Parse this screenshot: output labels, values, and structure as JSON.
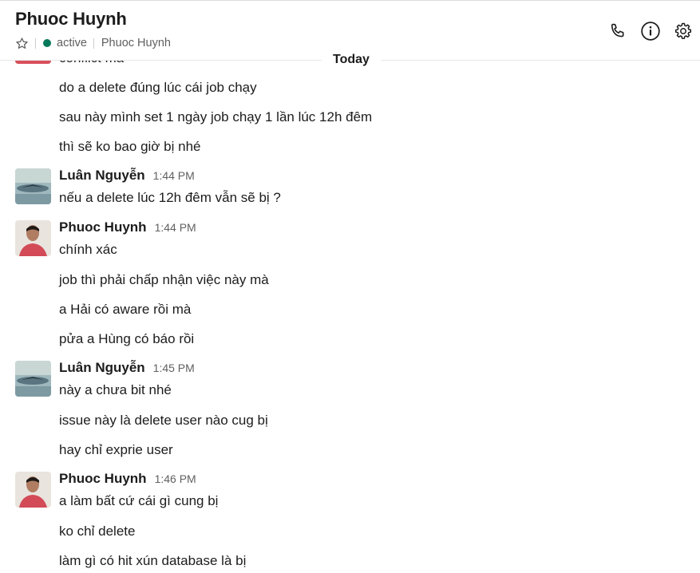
{
  "header": {
    "title": "Phuoc Huynh",
    "status": "active",
    "subtitle_name": "Phuoc Huynh",
    "icons": [
      "star-icon",
      "phone-icon",
      "info-icon",
      "gear-icon"
    ]
  },
  "divider_label": "Today",
  "cut_off_line": "conflict mà",
  "groups": [
    {
      "lines": [
        "do a delete đúng lúc cái job chạy",
        "sau này mình set 1 ngày job chạy 1 lần lúc 12h đêm",
        "thì sẽ ko bao giờ bị nhé"
      ]
    },
    {
      "author": "Luân Nguyễn",
      "time": "1:44 PM",
      "lines": [
        "nếu a delete lúc 12h đêm vẫn sẽ bị ?"
      ]
    },
    {
      "author": "Phuoc Huynh",
      "time": "1:44 PM",
      "lines": [
        "chính xác",
        "job thì phải chấp nhận việc này mà",
        "a Hải có aware rồi mà",
        "pửa a Hùng có báo rồi"
      ]
    },
    {
      "author": "Luân Nguyễn",
      "time": "1:45 PM",
      "lines": [
        "này a chưa bit nhé",
        "issue này là delete user nào cug bị",
        "hay chỉ exprie user"
      ]
    },
    {
      "author": "Phuoc Huynh",
      "time": "1:46 PM",
      "lines": [
        "a làm bất cứ cái gì cung bị",
        "ko chỉ delete",
        "làm gì có hit xún database là bị"
      ]
    }
  ]
}
